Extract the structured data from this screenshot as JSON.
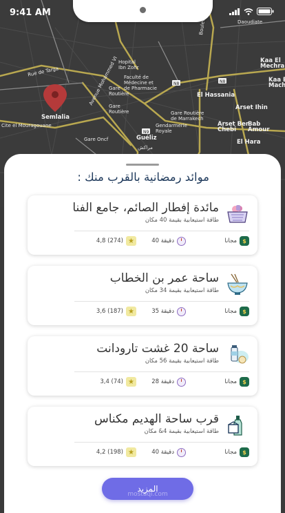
{
  "status_bar": {
    "time": "9:41 AM"
  },
  "map": {
    "labels": [
      {
        "text": "Daoudiate",
        "cls": ""
      },
      {
        "text": "Kaa El\nMechra",
        "cls": ""
      },
      {
        "text": "Kaa El\nMachra",
        "cls": ""
      },
      {
        "text": "Rue de Targa",
        "cls": ""
      },
      {
        "text": "Hopital\nIbn Zohr",
        "cls": ""
      },
      {
        "text": "Faculté de\nMédecine et\nde Pharmacie",
        "cls": ""
      },
      {
        "text": "El Hassania",
        "cls": "big"
      },
      {
        "text": "Gare\nRoutière",
        "cls": ""
      },
      {
        "text": "Semlalia",
        "cls": "big"
      },
      {
        "text": "Gare Routière\nde Marrakech",
        "cls": ""
      },
      {
        "text": "Gendarmerie\nRoyale",
        "cls": ""
      },
      {
        "text": "Arset Ihin",
        "cls": "big"
      },
      {
        "text": "Arset Ben\nChebi",
        "cls": "big"
      },
      {
        "text": "Bab\nAmour",
        "cls": "big"
      },
      {
        "text": "El Hara",
        "cls": "big"
      },
      {
        "text": "Guéliz",
        "cls": "big"
      },
      {
        "text": "Gare Oncf",
        "cls": ""
      },
      {
        "text": "Gare\nRoutière",
        "cls": ""
      },
      {
        "text": "مراكش",
        "cls": ""
      },
      {
        "text": "Boulevard Allal Al Fassi",
        "cls": ""
      },
      {
        "text": "Avenue Mohammed VI",
        "cls": ""
      },
      {
        "text": "Cite el Mouragouane",
        "cls": ""
      },
      {
        "text": "N8",
        "cls": ""
      },
      {
        "text": "N8",
        "cls": ""
      },
      {
        "text": "N9",
        "cls": ""
      }
    ]
  },
  "sheet": {
    "title": "موائد رمضانية بالقرب منك :",
    "more_button": "المزيد",
    "watermark": "mostaql.com",
    "cards": [
      {
        "name": "مائدة إفطار الصائم، جامع الفنا",
        "capacity": "طاقة استيعابية بقيمة 40 مكان",
        "price": "مجانا",
        "time": "40 دقيقة",
        "rating": "4,8 (274)",
        "icon": "food-basket-icon"
      },
      {
        "name": "ساحة عمر بن الخطاب",
        "capacity": "طاقة استيعابية بقيمة 34 مكان",
        "price": "مجانا",
        "time": "35 دقيقة",
        "rating": "3,6 (187)",
        "icon": "noodle-bowl-icon"
      },
      {
        "name": "ساحة 20 غشت تارودانت",
        "capacity": "طاقة استيعابية بقيمة 56 مكان",
        "price": "مجانا",
        "time": "28 دقيقة",
        "rating": "3,4 (74)",
        "icon": "milk-bread-icon"
      },
      {
        "name": "قرب ساحة الهديم مكناس",
        "capacity": "طاقة استيعابية بقيمة 4& مكان",
        "price": "مجانا",
        "time": "40 دقيقة",
        "rating": "4,2 (198)",
        "icon": "bottle-box-icon"
      }
    ]
  },
  "colors": {
    "accent": "#6f6ce6",
    "title": "#1f3a5c",
    "map_bg": "#3a3a3a",
    "map_road": "#b9a850",
    "pin": "#b53a3a"
  }
}
